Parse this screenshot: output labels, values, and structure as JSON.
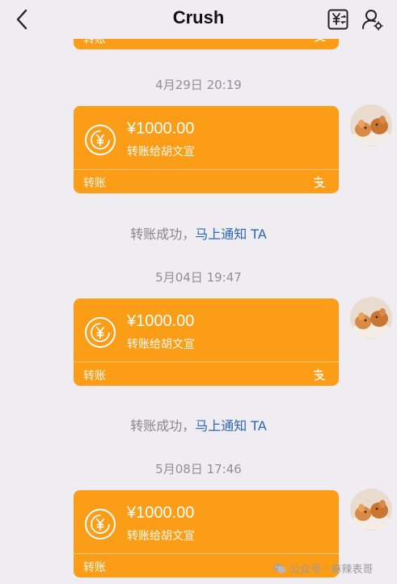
{
  "header": {
    "title": "Crush",
    "back_icon": "chevron-left-icon",
    "transfer_icon": "yuan-exchange-icon",
    "profile_icon": "person-settings-icon"
  },
  "colors": {
    "card": "#fb9d16",
    "link": "#2d67b5",
    "background": "#efedf1"
  },
  "top_card": {
    "footer_label": "转账"
  },
  "messages": [
    {
      "timestamp": "4月29日 20:19",
      "amount": "¥1000.00",
      "note": "转账给胡文宣",
      "footer_label": "转账",
      "status_text": "转账成功，",
      "status_link": "马上通知 TA"
    },
    {
      "timestamp": "5月04日 19:47",
      "amount": "¥1000.00",
      "note": "转账给胡文宣",
      "footer_label": "转账",
      "status_text": "转账成功，",
      "status_link": "马上通知 TA"
    },
    {
      "timestamp": "5月08日 17:46",
      "amount": "¥1000.00",
      "note": "转账给胡文宣",
      "footer_label": "转账"
    }
  ],
  "watermark": {
    "text": "公众号 · 麻辣表哥",
    "icon": "wechat-icon"
  }
}
